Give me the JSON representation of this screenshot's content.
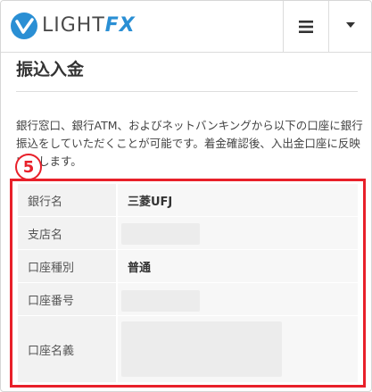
{
  "header": {
    "logo_text": "LIGHT",
    "logo_fx": "FX",
    "menu_icon": "hamburger-icon",
    "dropdown_icon": "caret-down-icon"
  },
  "page": {
    "title": "振込入金",
    "description": "銀行窓口、銀行ATM、およびネットバンキングから以下の口座に銀行振込をしていただくことが可能です。着金確認後、入出金口座に反映いたします。"
  },
  "annotation": {
    "badge": "5",
    "accent_color": "#e8202a"
  },
  "account_table": {
    "rows": [
      {
        "label": "銀行名",
        "value": "三菱UFJ"
      },
      {
        "label": "支店名",
        "value": ""
      },
      {
        "label": "口座種別",
        "value": "普通"
      },
      {
        "label": "口座番号",
        "value": ""
      },
      {
        "label": "口座名義",
        "value": ""
      }
    ]
  }
}
